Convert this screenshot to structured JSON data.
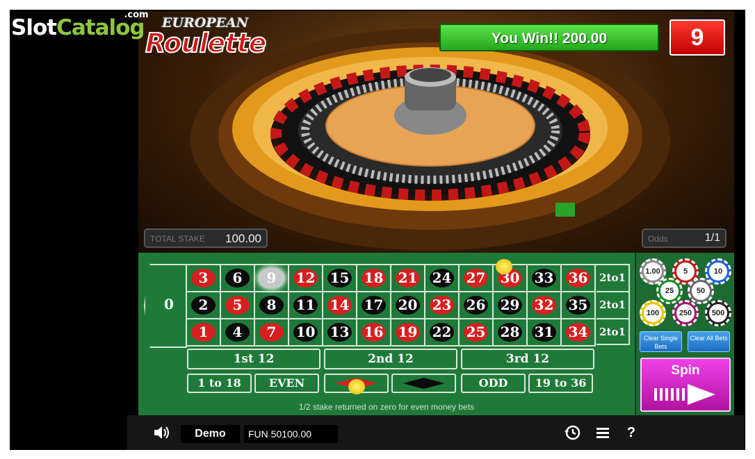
{
  "watermark": {
    "part1": "Slot",
    "part2": "Catalog",
    "sup": ".com"
  },
  "logo": {
    "line1": "EUROPEAN",
    "line2": "Roulette"
  },
  "win": {
    "label": "You Win!!  200.00"
  },
  "result": {
    "number": "9"
  },
  "stake": {
    "label": "TOTAL STAKE",
    "value": "100.00"
  },
  "odds": {
    "label": "Odds",
    "value": "1/1"
  },
  "table": {
    "zero": "0",
    "rows": [
      [
        [
          "3",
          "red"
        ],
        [
          "6",
          "blk"
        ],
        [
          "9",
          "red"
        ],
        [
          "12",
          "red"
        ],
        [
          "15",
          "blk"
        ],
        [
          "18",
          "red"
        ],
        [
          "21",
          "red"
        ],
        [
          "24",
          "blk"
        ],
        [
          "27",
          "red"
        ],
        [
          "30",
          "red"
        ],
        [
          "33",
          "blk"
        ],
        [
          "36",
          "red"
        ]
      ],
      [
        [
          "2",
          "blk"
        ],
        [
          "5",
          "red"
        ],
        [
          "8",
          "blk"
        ],
        [
          "11",
          "blk"
        ],
        [
          "14",
          "red"
        ],
        [
          "17",
          "blk"
        ],
        [
          "20",
          "blk"
        ],
        [
          "23",
          "red"
        ],
        [
          "26",
          "blk"
        ],
        [
          "29",
          "blk"
        ],
        [
          "32",
          "red"
        ],
        [
          "35",
          "blk"
        ]
      ],
      [
        [
          "1",
          "red"
        ],
        [
          "4",
          "blk"
        ],
        [
          "7",
          "red"
        ],
        [
          "10",
          "blk"
        ],
        [
          "13",
          "blk"
        ],
        [
          "16",
          "red"
        ],
        [
          "19",
          "red"
        ],
        [
          "22",
          "blk"
        ],
        [
          "25",
          "red"
        ],
        [
          "28",
          "blk"
        ],
        [
          "31",
          "blk"
        ],
        [
          "34",
          "red"
        ]
      ]
    ],
    "column_label": "2to1",
    "dozens": [
      "1st 12",
      "2nd 12",
      "3rd 12"
    ],
    "even_bets": [
      "1 to 18",
      "EVEN",
      "",
      "",
      "ODD",
      "19 to 36"
    ],
    "note": "1/2 stake returned on zero for even money bets",
    "selected_number": "9"
  },
  "chips": [
    {
      "label": "1.00",
      "color": "#8a8a8a"
    },
    {
      "label": "5",
      "color": "#c41818"
    },
    {
      "label": "10",
      "color": "#1f5fd6"
    },
    {
      "label": "25",
      "color": "#1f8a2a"
    },
    {
      "label": "50",
      "color": "#6a6a6a"
    },
    {
      "label": "100",
      "color": "#e8c400"
    },
    {
      "label": "250",
      "color": "#9a1a6a"
    },
    {
      "label": "500",
      "color": "#222222"
    }
  ],
  "buttons": {
    "clear_single": "Clear Single Bets",
    "clear_all": "Clear All Bets",
    "spin": "Spin"
  },
  "bottom": {
    "demo": "Demo",
    "balance": "FUN 50100.00"
  },
  "icons": {
    "sound": "speaker-icon",
    "history": "history-icon",
    "menu": "menu-icon",
    "help": "help-icon"
  }
}
